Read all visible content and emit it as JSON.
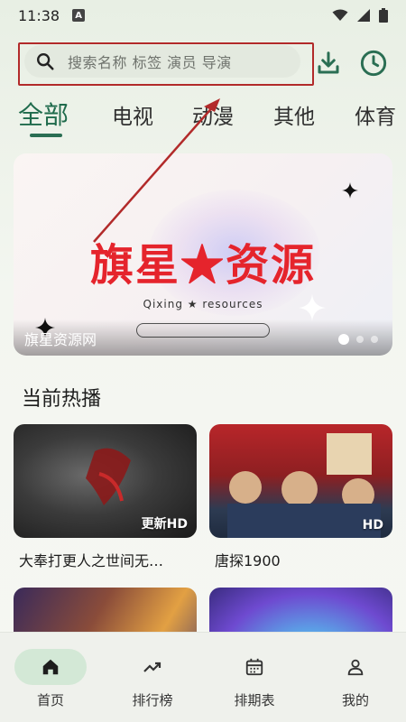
{
  "status_bar": {
    "time": "11:38",
    "notification_icon": "a-badge-icon",
    "icons": [
      "wifi-icon",
      "signal-icon",
      "battery-icon"
    ]
  },
  "search": {
    "placeholder": "搜索名称 标签 演员 导演",
    "icon": "search-icon"
  },
  "header_actions": {
    "download_icon": "download-icon",
    "history_icon": "history-clock-icon"
  },
  "tabs": [
    {
      "label": "全部",
      "active": true
    },
    {
      "label": "电视",
      "active": false
    },
    {
      "label": "动漫",
      "active": false
    },
    {
      "label": "其他",
      "active": false
    },
    {
      "label": "体育",
      "active": false
    }
  ],
  "banner": {
    "title": "旗星★资源",
    "subtitle": "Qixing ★ resources",
    "caption": "旗星资源网",
    "slide_count": 3,
    "active_slide": 1
  },
  "section": {
    "title": "当前热播"
  },
  "cards": [
    {
      "title": "大奉打更人之世间无…",
      "badge": "更新HD"
    },
    {
      "title": "唐探1900",
      "badge": "HD"
    },
    {
      "title": "",
      "badge": ""
    },
    {
      "title": "",
      "badge": ""
    }
  ],
  "bottom_nav": [
    {
      "label": "首页",
      "icon": "home-icon",
      "active": true
    },
    {
      "label": "排行榜",
      "icon": "trending-icon",
      "active": false
    },
    {
      "label": "排期表",
      "icon": "calendar-icon",
      "active": false
    },
    {
      "label": "我的",
      "icon": "person-icon",
      "active": false
    }
  ],
  "colors": {
    "accent": "#2a6e53",
    "annotation": "#b22a2a",
    "banner_title": "#e5242c"
  }
}
